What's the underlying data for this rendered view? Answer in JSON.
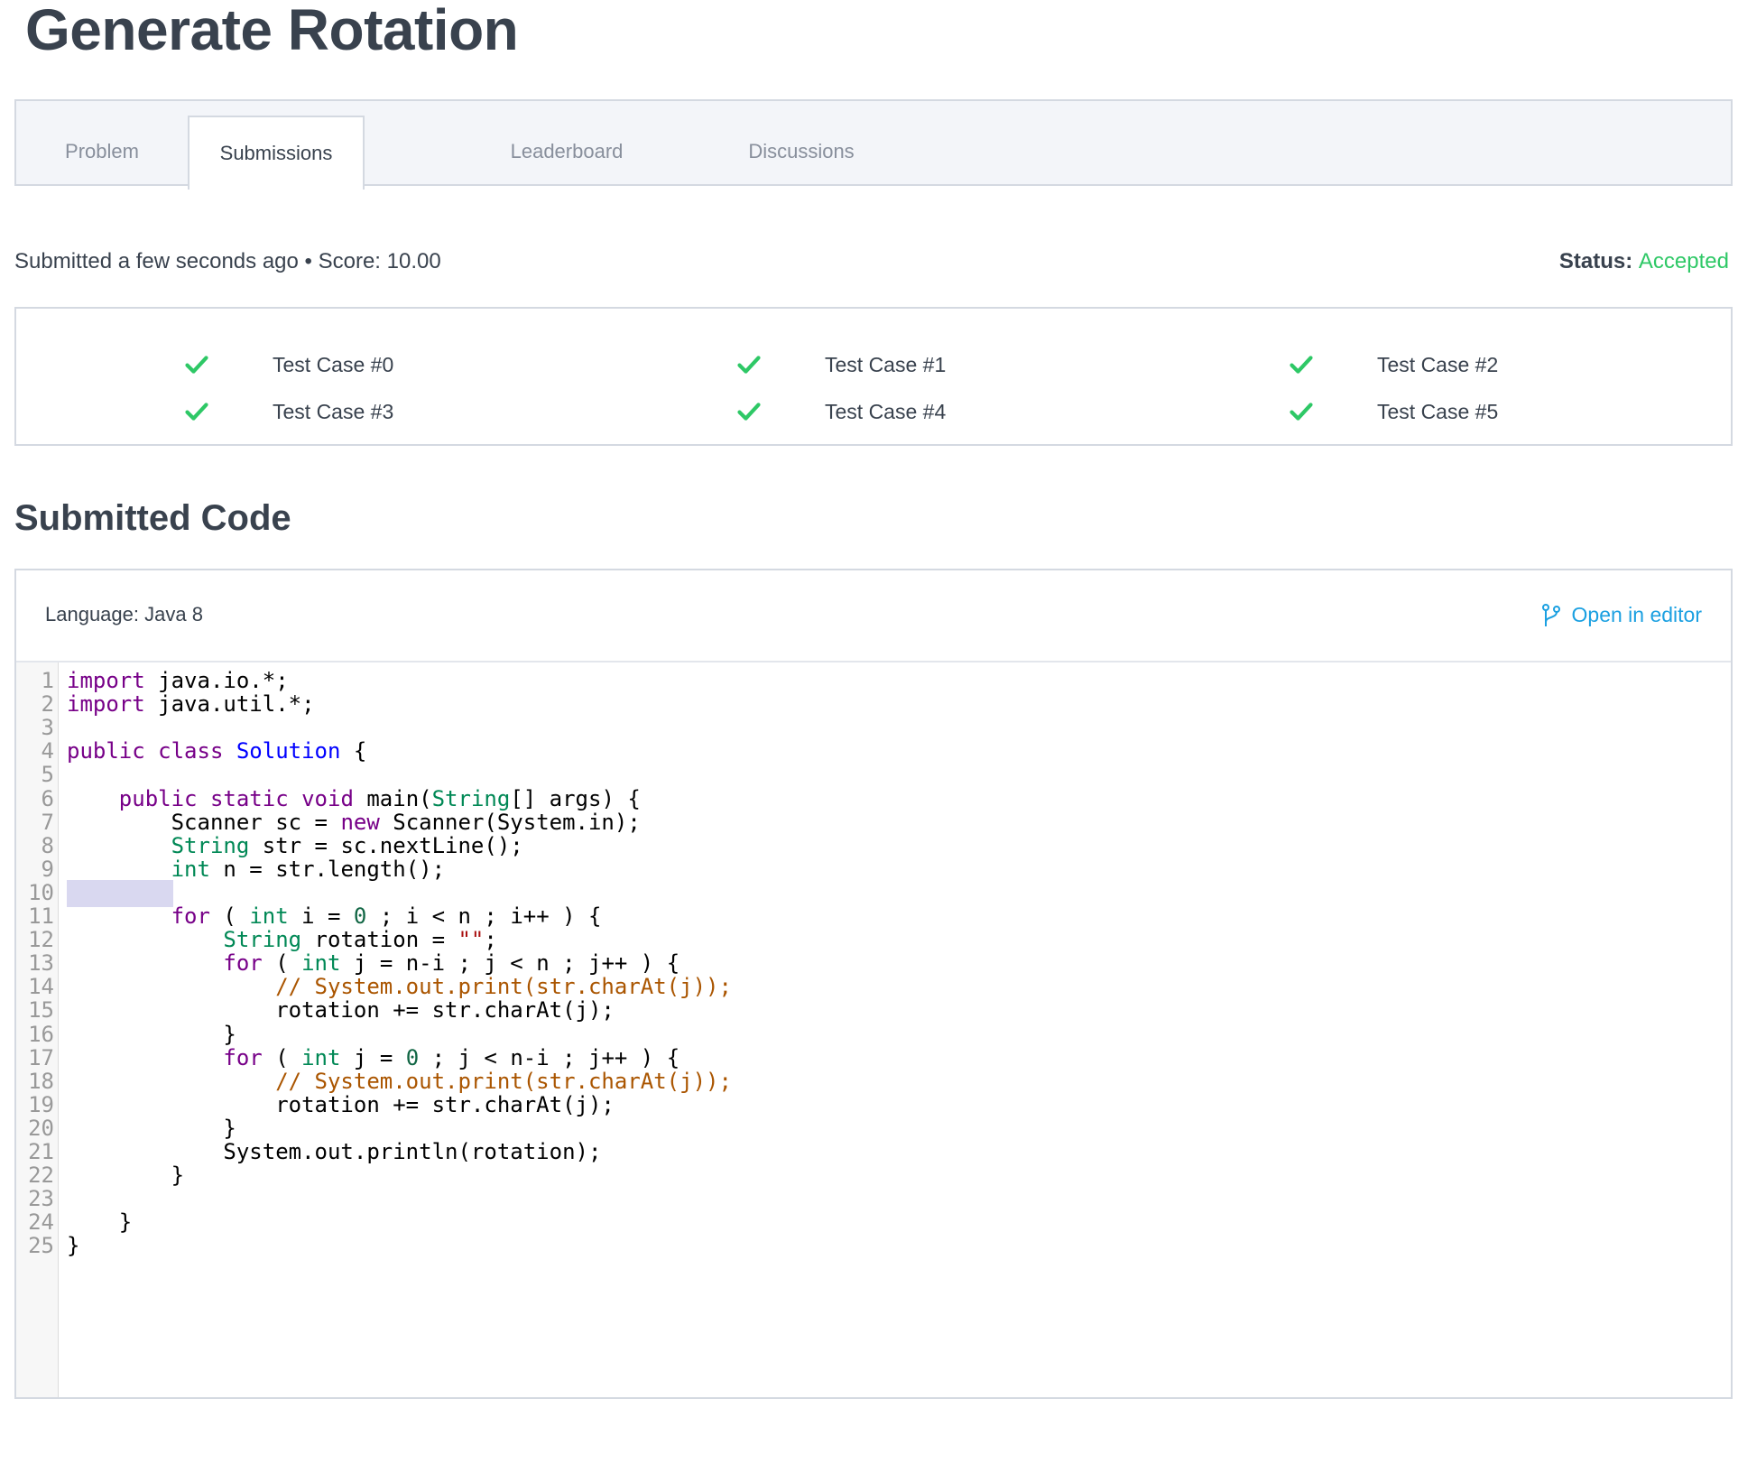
{
  "page": {
    "title": "Generate Rotation"
  },
  "tabs": [
    {
      "label": "Problem",
      "active": false
    },
    {
      "label": "Submissions",
      "active": true
    },
    {
      "label": "Leaderboard",
      "active": false
    },
    {
      "label": "Discussions",
      "active": false
    }
  ],
  "submission": {
    "meta": "Submitted a few seconds ago • Score: 10.00",
    "status_label": "Status:",
    "status_value": "Accepted"
  },
  "test_cases": [
    {
      "label": "Test Case #0",
      "passed": true
    },
    {
      "label": "Test Case #1",
      "passed": true
    },
    {
      "label": "Test Case #2",
      "passed": true
    },
    {
      "label": "Test Case #3",
      "passed": true
    },
    {
      "label": "Test Case #4",
      "passed": true
    },
    {
      "label": "Test Case #5",
      "passed": true
    }
  ],
  "code_section": {
    "title": "Submitted Code",
    "language": "Language: Java 8",
    "open_in_editor": "Open in editor",
    "highlighted_line": 10,
    "lines": [
      "import java.io.*;",
      "import java.util.*;",
      "",
      "public class Solution {",
      "",
      "    public static void main(String[] args) {",
      "        Scanner sc = new Scanner(System.in);",
      "        String str = sc.nextLine();",
      "        int n = str.length();",
      "",
      "        for ( int i = 0 ; i < n ; i++ ) {",
      "            String rotation = \"\";",
      "            for ( int j = n-i ; j < n ; j++ ) {",
      "                // System.out.print(str.charAt(j));",
      "                rotation += str.charAt(j);",
      "            }",
      "            for ( int j = 0 ; j < n-i ; j++ ) {",
      "                // System.out.print(str.charAt(j));",
      "                rotation += str.charAt(j);",
      "            }",
      "            System.out.println(rotation);",
      "        }",
      "",
      "    }",
      "}"
    ]
  },
  "colors": {
    "accepted": "#2ec866",
    "check": "#2ec866",
    "link": "#1ba0e1",
    "keyword": "#770088",
    "type": "#008855",
    "def": "#0000ff",
    "number": "#116644",
    "comment": "#aa5500",
    "string": "#aa1111"
  },
  "icons": {
    "test_pass": "check-icon",
    "open_editor": "branch-icon"
  }
}
